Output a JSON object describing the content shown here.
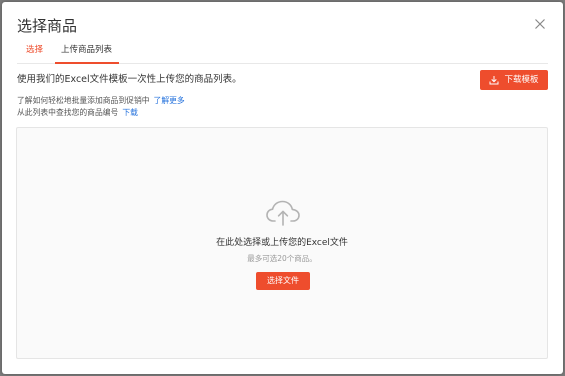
{
  "dialog": {
    "title": "选择商品",
    "tabs": [
      {
        "label": "选择"
      },
      {
        "label": "上传商品列表"
      }
    ],
    "active_tab": "上传商品列表"
  },
  "upload": {
    "intro": "使用我们的Excel文件模板一次性上传您的商品列表。",
    "download_template_label": "下载模板",
    "help": {
      "bulk_text": "了解如何轻松地批量添加商品到促销中",
      "bulk_link": "了解更多",
      "find_text": "从此列表中查找您的商品编号",
      "find_link": "下载"
    },
    "dropzone": {
      "main_text": "在此处选择或上传您的Excel文件",
      "limit_text": "最多可选20个商品。",
      "select_file_label": "选择文件"
    }
  },
  "icons": {
    "close": "close-icon",
    "download": "download-icon",
    "upload": "cloud-upload-icon"
  },
  "colors": {
    "accent": "#ee4d2d",
    "link": "#2673dd",
    "text": "#333333",
    "muted": "#999999"
  }
}
